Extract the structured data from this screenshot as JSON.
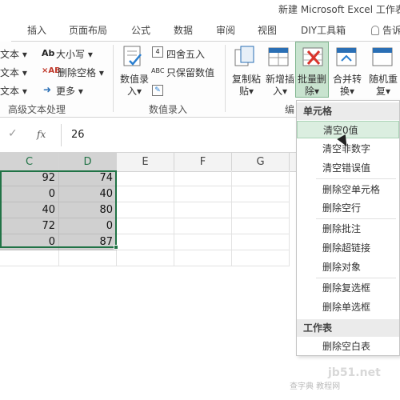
{
  "window": {
    "title": "新建 Microsoft Excel 工作表"
  },
  "tabs": [
    "插入",
    "页面布局",
    "公式",
    "数据",
    "审阅",
    "视图",
    "DIY工具箱"
  ],
  "tell_me": "告诉",
  "ribbon": {
    "text_group": {
      "label": "高级文本处理",
      "left_items": [
        "文本 ▾",
        "文本 ▾",
        "文本 ▾"
      ],
      "upper_lower": "大小写 ▾",
      "remove_space": "删除空格 ▾",
      "more": "更多 ▾"
    },
    "number_group": {
      "label": "数值录入",
      "value_input": "数值录入▾",
      "round": "四舍五入",
      "keep_value": "只保留数值"
    },
    "edit_group": {
      "copy_paste": "复制粘贴▾",
      "insert_new": "新增插入▾",
      "batch_delete": "批量删除▾",
      "merge_convert": "合并转换▾",
      "random": "随机重复▾",
      "edit_label": "编"
    }
  },
  "formula_bar": {
    "fx": "fx",
    "value": "26"
  },
  "columns": [
    "C",
    "D",
    "E",
    "F",
    "G"
  ],
  "cells": [
    [
      "92",
      "74"
    ],
    [
      "0",
      "40"
    ],
    [
      "40",
      "80"
    ],
    [
      "72",
      "0"
    ],
    [
      "0",
      "87"
    ]
  ],
  "menu": {
    "header_cell": "单元格",
    "items_cell": [
      "清空0值",
      "清空非数字",
      "清空错误值",
      "删除空单元格",
      "删除空行",
      "删除批注",
      "删除超链接",
      "删除对象",
      "删除复选框",
      "删除单选框"
    ],
    "header_sheet": "工作表",
    "items_sheet": [
      "删除空白表"
    ]
  },
  "watermark": {
    "line1": "jb51.net",
    "line2": "查字典 教程网"
  }
}
